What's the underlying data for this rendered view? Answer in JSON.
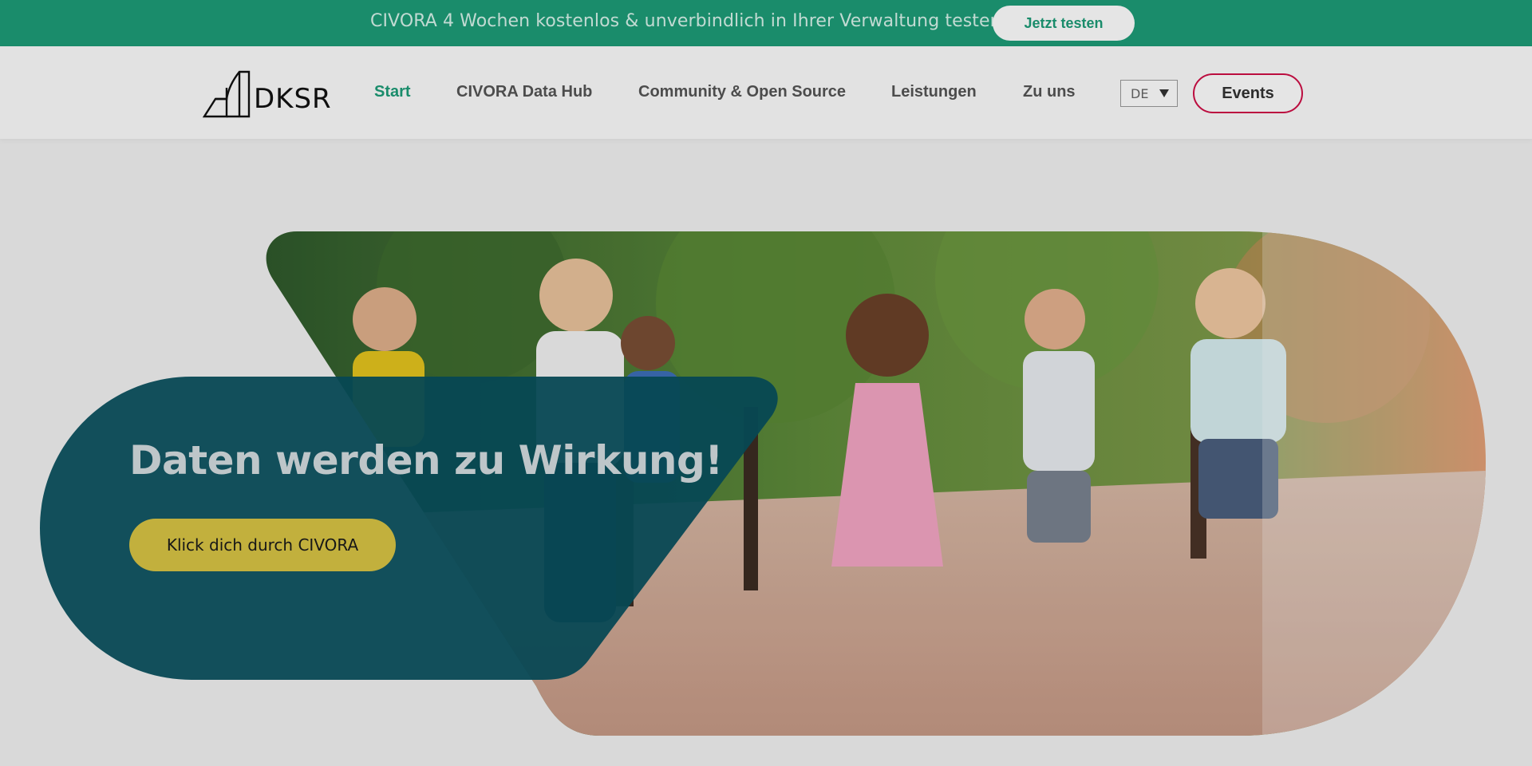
{
  "promo": {
    "text": "CIVORA 4 Wochen kostenlos & unverbindlich in Ihrer Verwaltung testen",
    "button_label": "Jetzt testen"
  },
  "header": {
    "logo_text": "DKSR",
    "nav": [
      {
        "label": "Start",
        "active": true
      },
      {
        "label": "CIVORA Data Hub",
        "active": false
      },
      {
        "label": "Community & Open Source",
        "active": false
      },
      {
        "label": "Leistungen",
        "active": false
      },
      {
        "label": "Zu uns",
        "active": false
      }
    ],
    "language": "DE",
    "events_label": "Events"
  },
  "hero": {
    "title": "Daten werden zu Wirkung!",
    "cta_label": "Klick dich durch CIVORA"
  },
  "colors": {
    "brand_green": "#1d9c78",
    "hero_card": "#08505e",
    "cta_yellow": "#d8c544",
    "events_border": "#d10f47"
  },
  "icons": {
    "logo": "dksr-logo-icon",
    "lang_arrow": "caret-down-icon"
  }
}
